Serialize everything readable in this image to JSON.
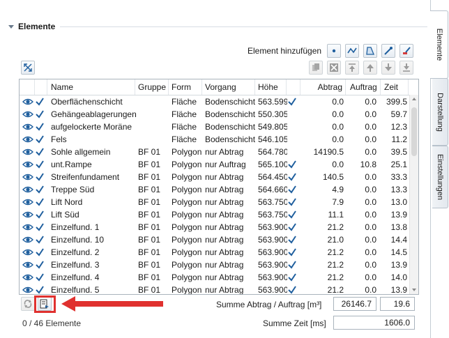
{
  "section": {
    "title": "Elemente"
  },
  "toolbar": {
    "add_label": "Element hinzufügen"
  },
  "columns": [
    "Name",
    "Gruppe",
    "Form",
    "Vorgang",
    "Höhe",
    "Abtrag",
    "Auftrag",
    "Zeit"
  ],
  "rows": [
    {
      "name": "Oberflächenschicht",
      "gruppe": "",
      "form": "Fläche",
      "vorgang": "Bodenschicht",
      "hoehe": "563.599",
      "check2": true,
      "abtrag": "0.0",
      "auftrag": "0.0",
      "zeit": "399.5"
    },
    {
      "name": "Gehängeablagerungen",
      "gruppe": "",
      "form": "Fläche",
      "vorgang": "Bodenschicht",
      "hoehe": "550.305",
      "check2": false,
      "abtrag": "0.0",
      "auftrag": "0.0",
      "zeit": "59.7"
    },
    {
      "name": "aufgelockerte Moräne",
      "gruppe": "",
      "form": "Fläche",
      "vorgang": "Bodenschicht",
      "hoehe": "549.805",
      "check2": false,
      "abtrag": "0.0",
      "auftrag": "0.0",
      "zeit": "12.3"
    },
    {
      "name": "Fels",
      "gruppe": "",
      "form": "Fläche",
      "vorgang": "Bodenschicht",
      "hoehe": "546.105",
      "check2": false,
      "abtrag": "0.0",
      "auftrag": "0.0",
      "zeit": "11.2"
    },
    {
      "name": "Sohle allgemein",
      "gruppe": "BF 01",
      "form": "Polygon",
      "vorgang": "nur Abtrag",
      "hoehe": "564.780",
      "check2": false,
      "abtrag": "14190.5",
      "auftrag": "0.0",
      "zeit": "39.5"
    },
    {
      "name": "unt.Rampe",
      "gruppe": "BF 01",
      "form": "Polygon",
      "vorgang": "nur Auftrag",
      "hoehe": "565.100",
      "check2": true,
      "abtrag": "0.0",
      "auftrag": "10.8",
      "zeit": "25.1"
    },
    {
      "name": "Streifenfundament",
      "gruppe": "BF 01",
      "form": "Polygon",
      "vorgang": "nur Abtrag",
      "hoehe": "564.450",
      "check2": true,
      "abtrag": "140.5",
      "auftrag": "0.0",
      "zeit": "33.3"
    },
    {
      "name": "Treppe Süd",
      "gruppe": "BF 01",
      "form": "Polygon",
      "vorgang": "nur Abtrag",
      "hoehe": "564.660",
      "check2": true,
      "abtrag": "4.9",
      "auftrag": "0.0",
      "zeit": "13.3"
    },
    {
      "name": "Lift Nord",
      "gruppe": "BF 01",
      "form": "Polygon",
      "vorgang": "nur Abtrag",
      "hoehe": "563.750",
      "check2": true,
      "abtrag": "7.9",
      "auftrag": "0.0",
      "zeit": "13.0"
    },
    {
      "name": "Lift Süd",
      "gruppe": "BF 01",
      "form": "Polygon",
      "vorgang": "nur Abtrag",
      "hoehe": "563.750",
      "check2": true,
      "abtrag": "11.1",
      "auftrag": "0.0",
      "zeit": "13.9"
    },
    {
      "name": "Einzelfund. 1",
      "gruppe": "BF 01",
      "form": "Polygon",
      "vorgang": "nur Abtrag",
      "hoehe": "563.900",
      "check2": true,
      "abtrag": "21.2",
      "auftrag": "0.0",
      "zeit": "13.8"
    },
    {
      "name": "Einzelfund. 10",
      "gruppe": "BF 01",
      "form": "Polygon",
      "vorgang": "nur Abtrag",
      "hoehe": "563.900",
      "check2": true,
      "abtrag": "21.0",
      "auftrag": "0.0",
      "zeit": "14.4"
    },
    {
      "name": "Einzelfund. 2",
      "gruppe": "BF 01",
      "form": "Polygon",
      "vorgang": "nur Abtrag",
      "hoehe": "563.900",
      "check2": true,
      "abtrag": "21.2",
      "auftrag": "0.0",
      "zeit": "14.5"
    },
    {
      "name": "Einzelfund. 3",
      "gruppe": "BF 01",
      "form": "Polygon",
      "vorgang": "nur Abtrag",
      "hoehe": "563.900",
      "check2": true,
      "abtrag": "21.2",
      "auftrag": "0.0",
      "zeit": "13.9"
    },
    {
      "name": "Einzelfund. 4",
      "gruppe": "BF 01",
      "form": "Polygon",
      "vorgang": "nur Abtrag",
      "hoehe": "563.900",
      "check2": true,
      "abtrag": "21.2",
      "auftrag": "0.0",
      "zeit": "14.0"
    },
    {
      "name": "Einzelfund. 5",
      "gruppe": "BF 01",
      "form": "Polygon",
      "vorgang": "nur Abtrag",
      "hoehe": "563.900",
      "check2": true,
      "abtrag": "21.2",
      "auftrag": "0.0",
      "zeit": "13.9"
    }
  ],
  "summary": {
    "abtrag_auftrag_label": "Summe Abtrag / Auftrag [m³]",
    "abtrag_value": "26146.7",
    "auftrag_value": "19.6",
    "zeit_label": "Summe Zeit [ms]",
    "zeit_value": "1606.0"
  },
  "status": {
    "count": "0 / 46 Elemente"
  },
  "tabs": [
    "Elemente",
    "Darstellung",
    "Einstellungen"
  ],
  "colors": {
    "icon_blue": "#1f5f9e",
    "highlight_red": "#e0312f",
    "border": "#a9b3bc"
  }
}
